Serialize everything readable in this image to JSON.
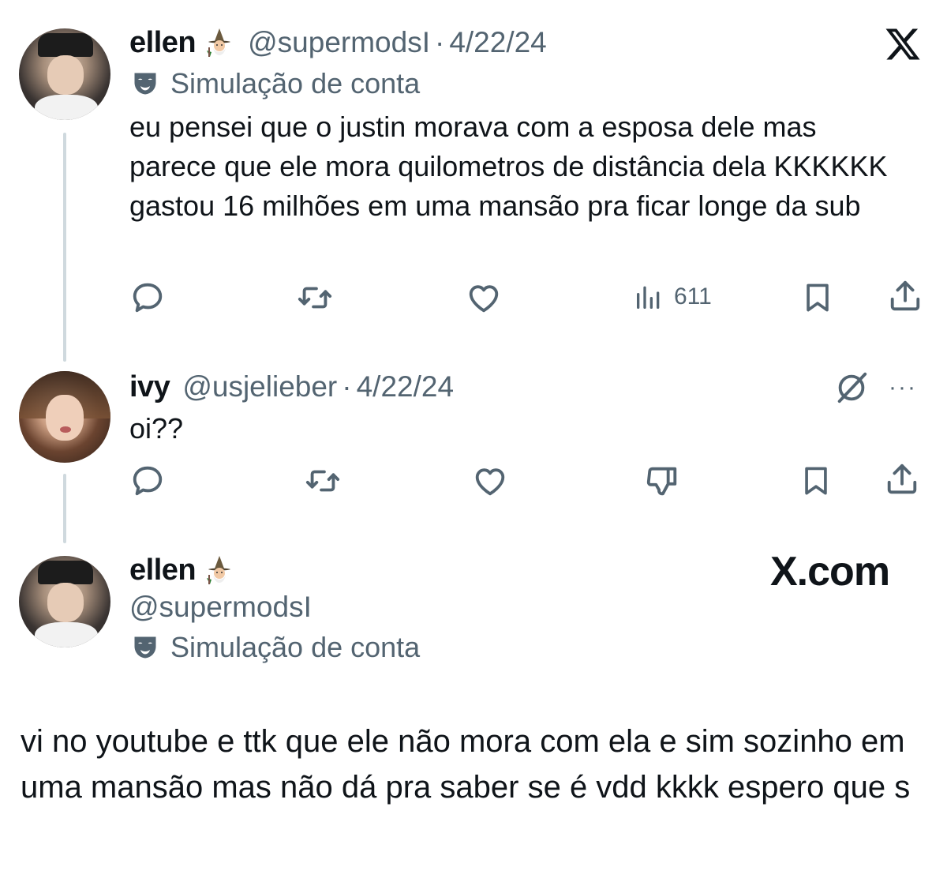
{
  "tweet1": {
    "name": "ellen",
    "handle": "@supermodsI",
    "dot": "·",
    "date": "4/22/24",
    "label": "Simulação de conta",
    "text": "eu pensei que o justin morava com a esposa dele mas parece que ele mora quilometros de distância dela KKKKKK gastou 16 milhões em uma mansão pra ficar longe da sub",
    "views": "611"
  },
  "tweet2": {
    "name": "ivy",
    "handle": "@usjelieber",
    "dot": "·",
    "date": "4/22/24",
    "text": "oi??",
    "more": "···"
  },
  "profile": {
    "name": "ellen",
    "handle": "@supermodsI",
    "label": "Simulação de conta",
    "brand": "X.com"
  },
  "footer": {
    "text": "vi no youtube e ttk que ele não mora com ela e sim sozinho em uma mansão mas não dá pra saber se é vdd kkkk espero que s"
  },
  "icons": {
    "reply": "reply-icon",
    "retweet": "retweet-icon",
    "like": "heart-icon",
    "views": "views-icon",
    "bookmark": "bookmark-icon",
    "share": "share-icon",
    "dislike": "dislike-icon",
    "grok": "grok-icon",
    "x_logo": "x-logo-icon",
    "mask": "mask-icon",
    "wizard": "wizard-emoji-icon"
  },
  "colors": {
    "text": "#0f1419",
    "muted": "#536471",
    "line": "#cfd9de"
  }
}
